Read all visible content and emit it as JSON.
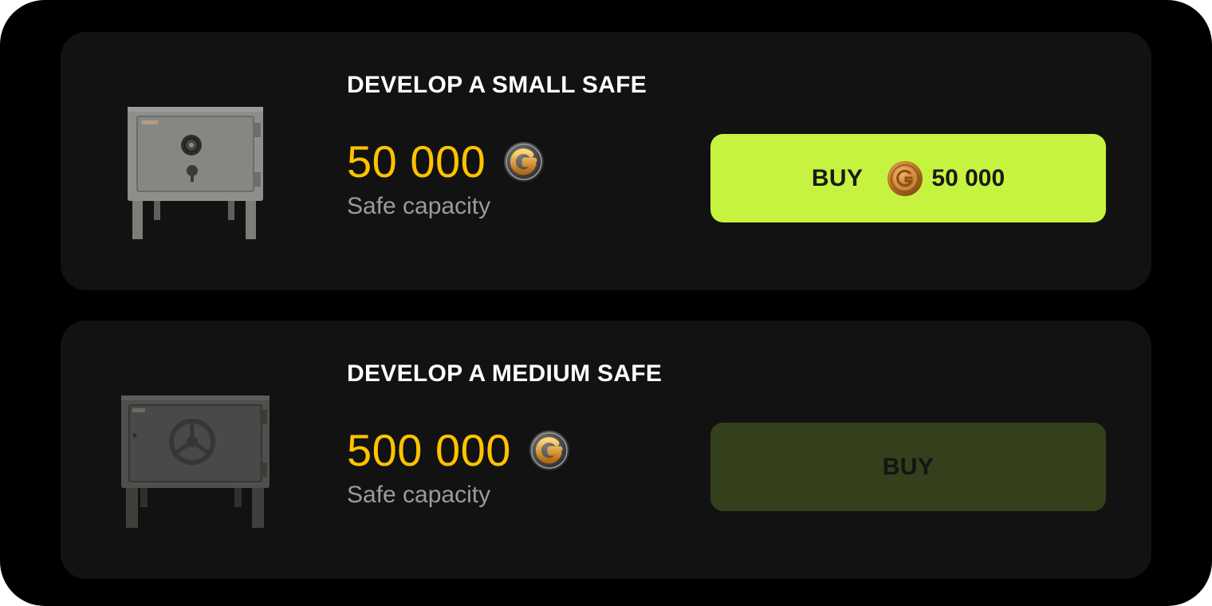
{
  "offers": [
    {
      "title": "DEVELOP A SMALL SAFE",
      "amount": "50 000",
      "currency_icon": "g-coin-icon",
      "caption": "Safe capacity",
      "buy_label": "BUY",
      "buy_price": "50 000",
      "buy_enabled": true,
      "safe_color": "#8c8f8a"
    },
    {
      "title": "DEVELOP A MEDIUM SAFE",
      "amount": "500 000",
      "currency_icon": "g-coin-icon",
      "caption": "Safe capacity",
      "buy_label": "BUY",
      "buy_enabled": false,
      "safe_color": "#4d504c"
    }
  ],
  "colors": {
    "background": "#000000",
    "card": "#121212",
    "accent_amount": "#ffc300",
    "button_active": "#c6f33f",
    "button_disabled": "#343f1c"
  }
}
